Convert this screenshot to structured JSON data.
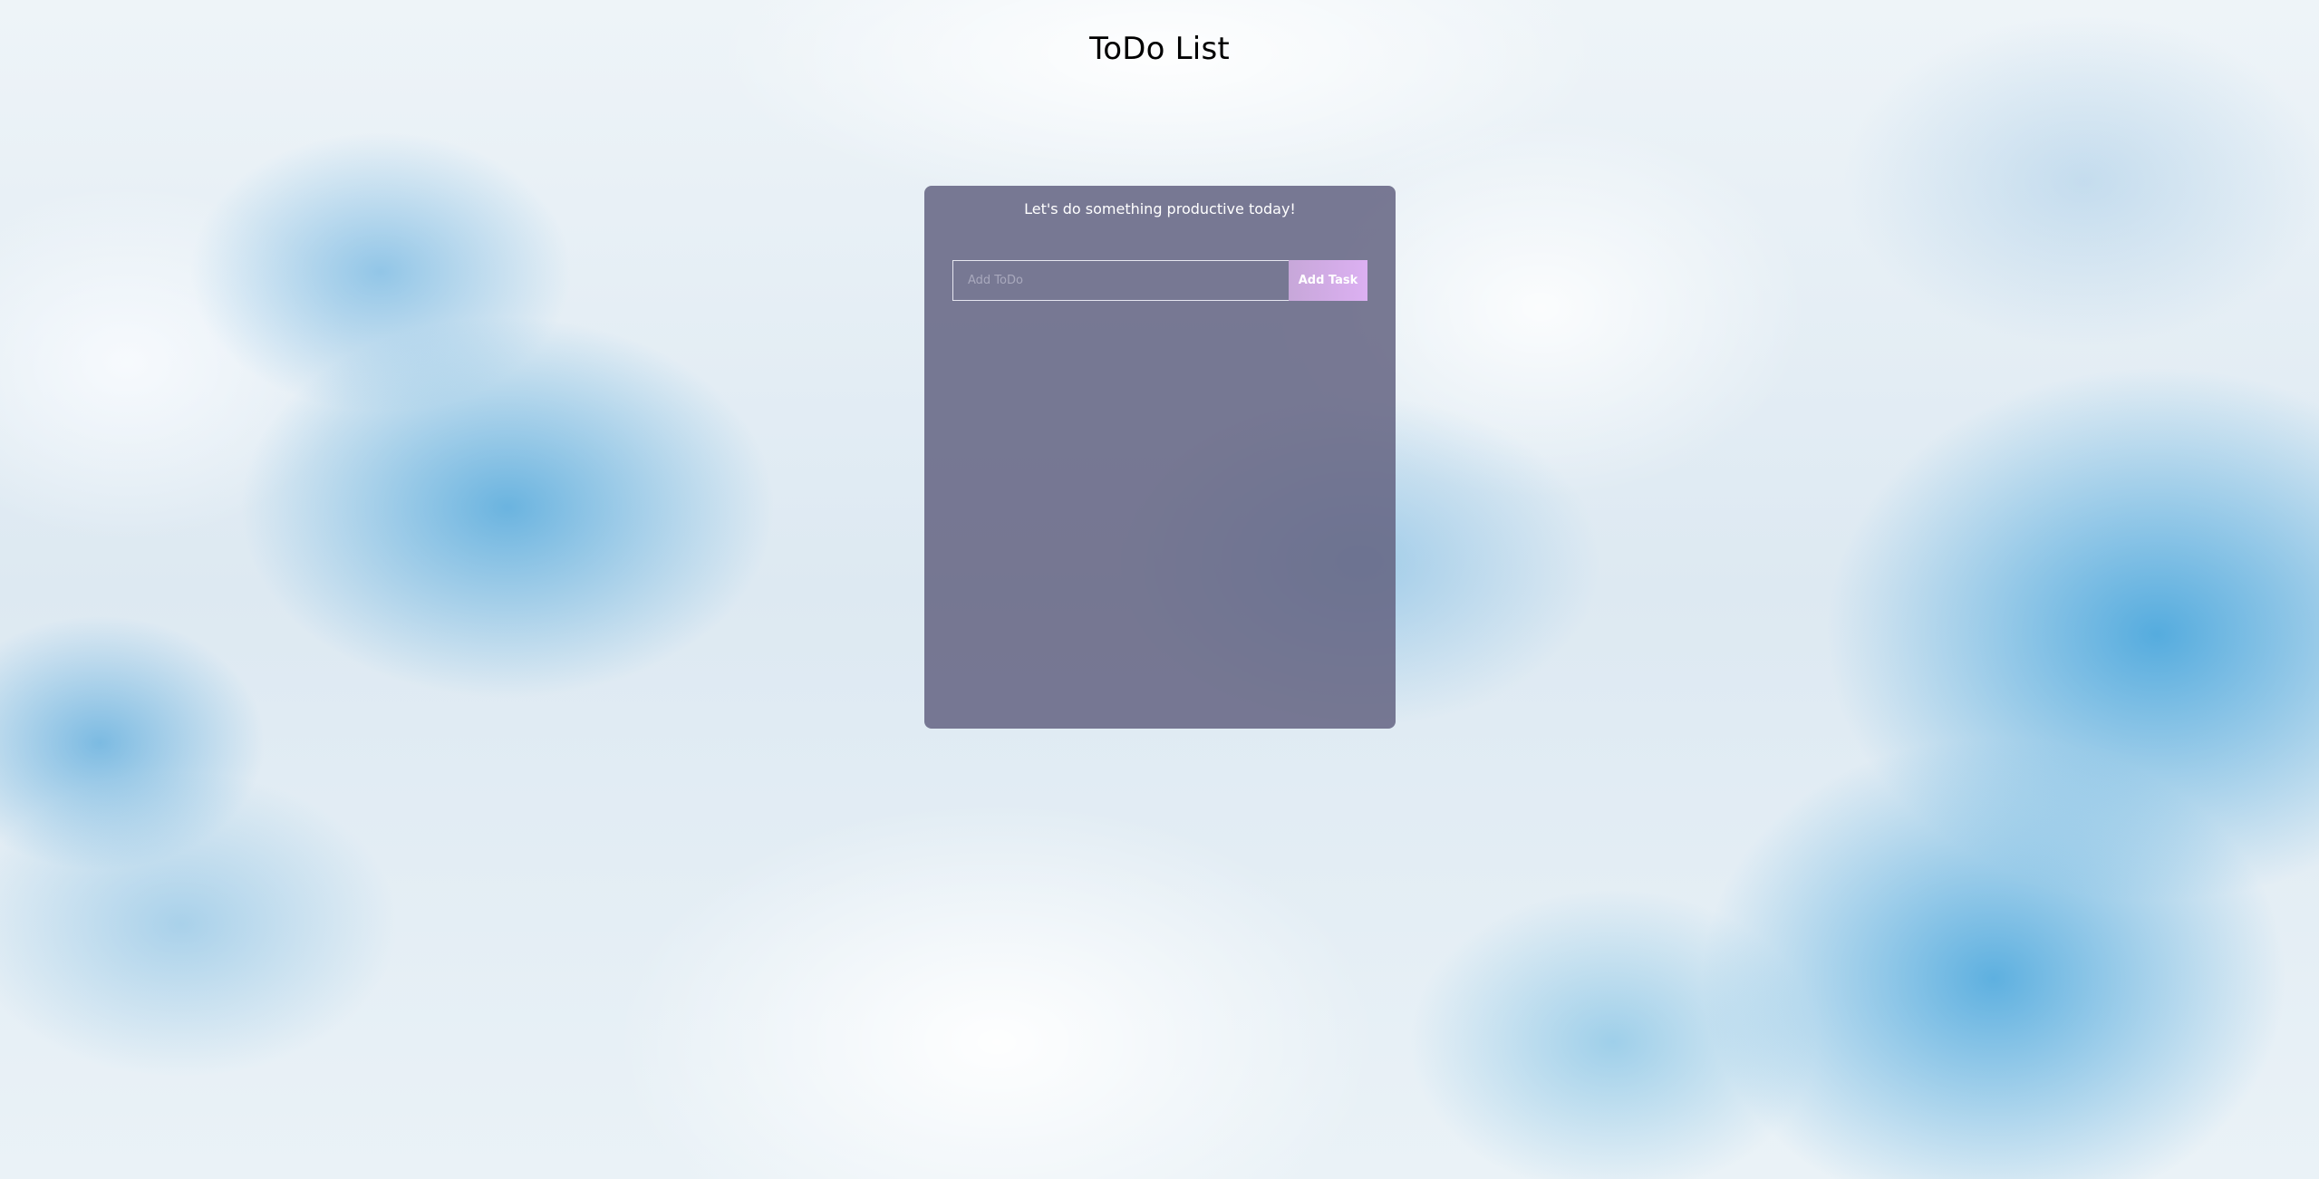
{
  "app": {
    "title": "ToDo List"
  },
  "card": {
    "subtitle": "Let's do something productive today!",
    "input": {
      "placeholder": "Add ToDo",
      "value": ""
    },
    "add_button_label": "Add Task",
    "tasks": []
  },
  "colors": {
    "card_background": "#646482",
    "button_gradient_start": "#c7a7d9",
    "button_gradient_end": "#dcb0f2",
    "text_light": "#ffffff",
    "title_text": "#000000"
  }
}
